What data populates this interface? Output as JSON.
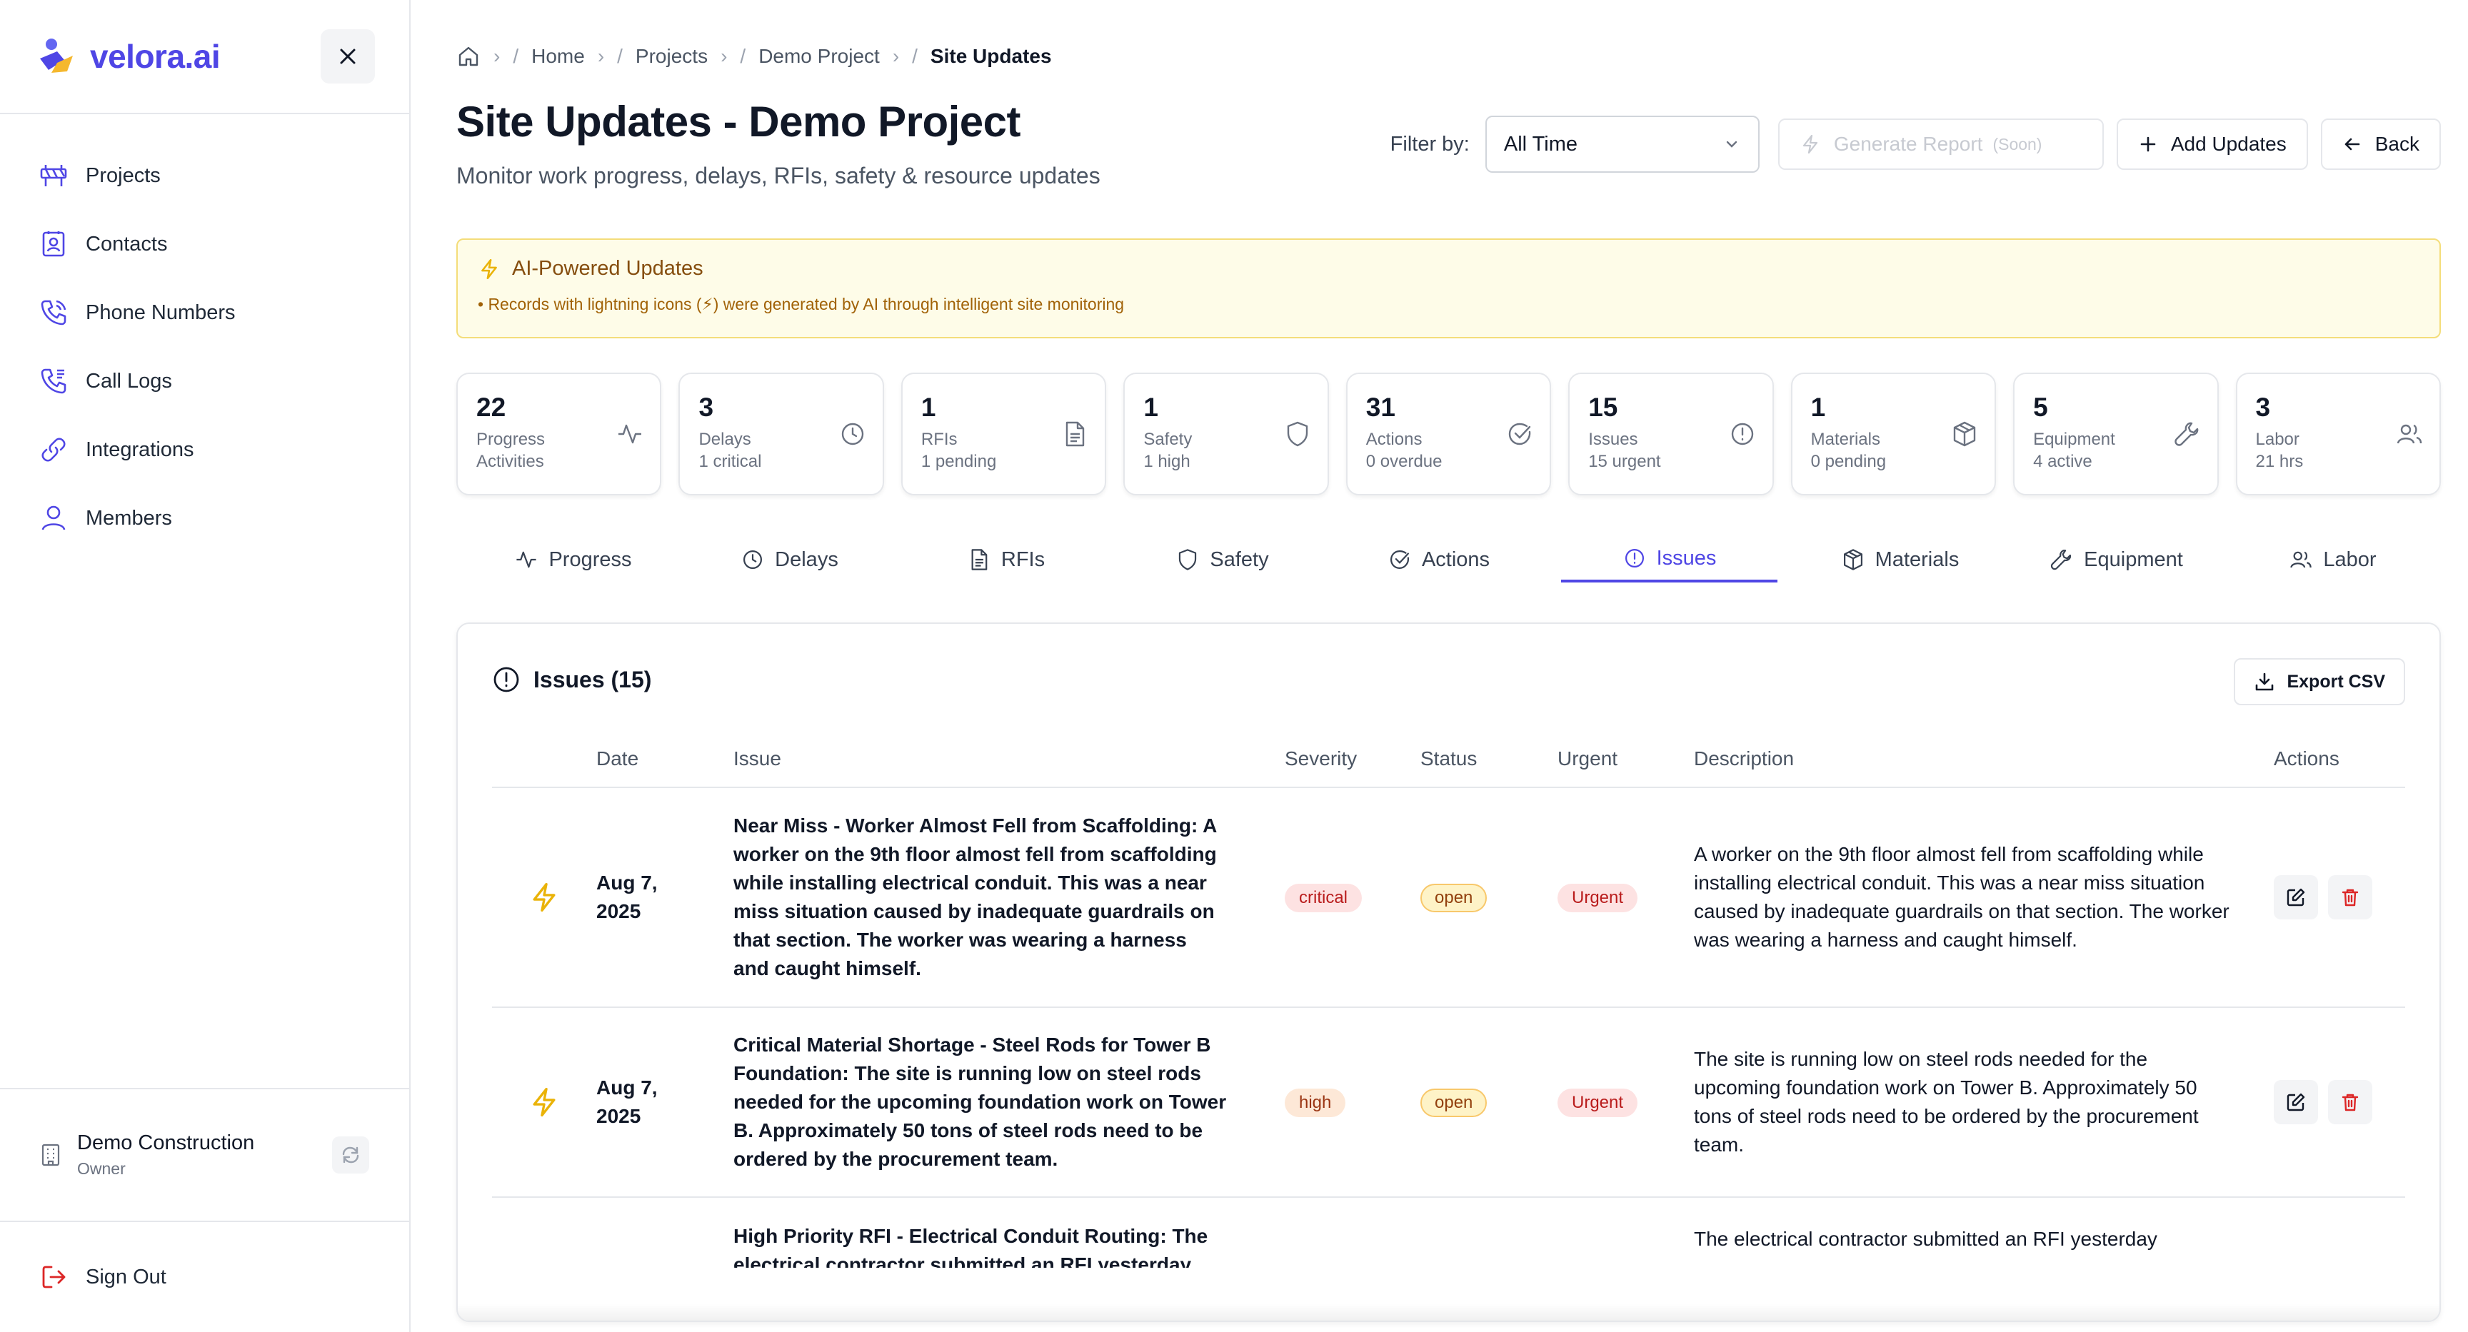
{
  "brand": {
    "name": "velora.ai"
  },
  "sidebar": {
    "items": [
      {
        "label": "Projects",
        "icon": "construction-barrier-icon"
      },
      {
        "label": "Contacts",
        "icon": "contact-book-icon"
      },
      {
        "label": "Phone Numbers",
        "icon": "phone-icon"
      },
      {
        "label": "Call Logs",
        "icon": "call-log-icon"
      },
      {
        "label": "Integrations",
        "icon": "link-icon"
      },
      {
        "label": "Members",
        "icon": "users-icon"
      }
    ],
    "org": {
      "name": "Demo Construction",
      "role": "Owner"
    },
    "signout_label": "Sign Out"
  },
  "breadcrumb": {
    "items": [
      "Home",
      "Projects",
      "Demo Project"
    ],
    "current": "Site Updates"
  },
  "header": {
    "title": "Site Updates - Demo Project",
    "subtitle": "Monitor work progress, delays, RFIs, safety & resource updates"
  },
  "toolbar": {
    "filter_label": "Filter by:",
    "filter_value": "All Time",
    "generate_label": "Generate Report",
    "generate_soon": "(Soon)",
    "add_label": "Add Updates",
    "back_label": "Back"
  },
  "banner": {
    "title": "AI-Powered Updates",
    "text": "• Records with lightning icons (⚡) were generated by AI through intelligent site monitoring"
  },
  "stats": [
    {
      "value": "22",
      "label": "Progress",
      "sub": "Activities",
      "icon": "activity-icon"
    },
    {
      "value": "3",
      "label": "Delays",
      "sub": "1 critical",
      "icon": "clock-icon"
    },
    {
      "value": "1",
      "label": "RFIs",
      "sub": "1 pending",
      "icon": "document-icon"
    },
    {
      "value": "1",
      "label": "Safety",
      "sub": "1 high",
      "icon": "shield-icon"
    },
    {
      "value": "31",
      "label": "Actions",
      "sub": "0 overdue",
      "icon": "check-circle-icon"
    },
    {
      "value": "15",
      "label": "Issues",
      "sub": "15 urgent",
      "icon": "alert-circle-icon"
    },
    {
      "value": "1",
      "label": "Materials",
      "sub": "0 pending",
      "icon": "package-icon"
    },
    {
      "value": "5",
      "label": "Equipment",
      "sub": "4 active",
      "icon": "wrench-icon"
    },
    {
      "value": "3",
      "label": "Labor",
      "sub": "21 hrs",
      "icon": "users-icon"
    }
  ],
  "tabs": [
    {
      "label": "Progress",
      "active": false
    },
    {
      "label": "Delays",
      "active": false
    },
    {
      "label": "RFIs",
      "active": false
    },
    {
      "label": "Safety",
      "active": false
    },
    {
      "label": "Actions",
      "active": false
    },
    {
      "label": "Issues",
      "active": true
    },
    {
      "label": "Materials",
      "active": false
    },
    {
      "label": "Equipment",
      "active": false
    },
    {
      "label": "Labor",
      "active": false
    }
  ],
  "issues": {
    "title": "Issues (15)",
    "export_label": "Export CSV",
    "columns": [
      "Date",
      "Issue",
      "Severity",
      "Status",
      "Urgent",
      "Description",
      "Actions"
    ],
    "rows": [
      {
        "date": "Aug 7, 2025",
        "issue": "Near Miss - Worker Almost Fell from Scaffolding: A worker on the 9th floor almost fell from scaffolding while installing electrical conduit. This was a near miss situation caused by inadequate guardrails on that section. The worker was wearing a harness and caught himself.",
        "severity": "critical",
        "status": "open",
        "urgent": "Urgent",
        "description": "A worker on the 9th floor almost fell from scaffolding while installing electrical conduit. This was a near miss situation caused by inadequate guardrails on that section. The worker was wearing a harness and caught himself."
      },
      {
        "date": "Aug 7, 2025",
        "issue": "Critical Material Shortage - Steel Rods for Tower B Foundation: The site is running low on steel rods needed for the upcoming foundation work on Tower B. Approximately 50 tons of steel rods need to be ordered by the procurement team.",
        "severity": "high",
        "status": "open",
        "urgent": "Urgent",
        "description": "The site is running low on steel rods needed for the upcoming foundation work on Tower B. Approximately 50 tons of steel rods need to be ordered by the procurement team."
      },
      {
        "date": "",
        "issue": "High Priority RFI - Electrical Conduit Routing: The electrical contractor submitted an RFI yesterday",
        "severity": "",
        "status": "",
        "urgent": "",
        "description": "The electrical contractor submitted an RFI yesterday"
      }
    ]
  },
  "colors": {
    "accent": "#4f46e5",
    "banner_bg": "#fefce8",
    "lightning": "#eab308",
    "danger": "#dc2626"
  }
}
